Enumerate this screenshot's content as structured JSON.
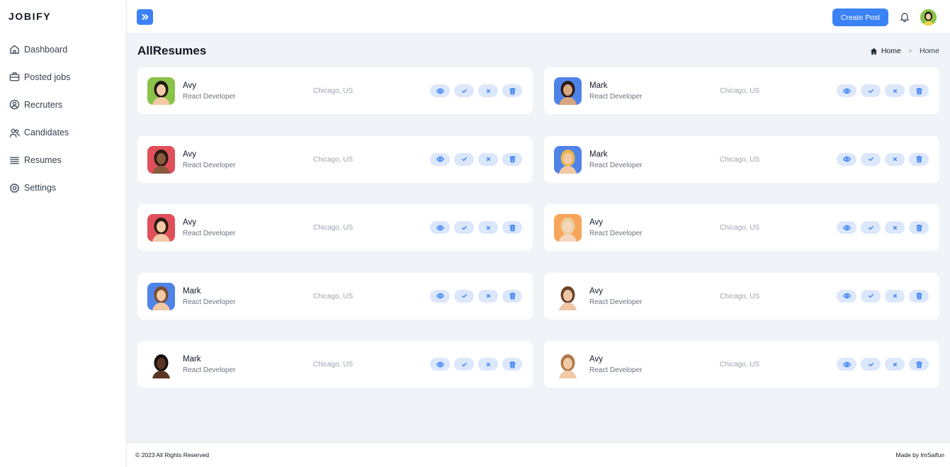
{
  "brand": "JOBIFY",
  "sidebar": {
    "items": [
      {
        "label": "Dashboard",
        "icon": "home-icon"
      },
      {
        "label": "Posted jobs",
        "icon": "briefcase-icon"
      },
      {
        "label": "Recruters",
        "icon": "user-circle-icon"
      },
      {
        "label": "Candidates",
        "icon": "users-icon"
      },
      {
        "label": "Resumes",
        "icon": "list-icon"
      },
      {
        "label": "Settings",
        "icon": "gear-icon"
      }
    ]
  },
  "topbar": {
    "create_label": "Create Post",
    "toggle_icon": "double-chevron-right-icon",
    "bell_icon": "bell-icon"
  },
  "page": {
    "title": "AllResumes",
    "breadcrumb": [
      "Home",
      "Home"
    ]
  },
  "resumes": [
    {
      "name": "Avy",
      "role": "React Developer",
      "location": "Chicago, US",
      "avatar_bg": "#8bc34a",
      "skin": "#f1c9a5",
      "hair": "#1f1612"
    },
    {
      "name": "Mark",
      "role": "React Developer",
      "location": "Chicago, US",
      "avatar_bg": "#4f83e8",
      "skin": "#d9a77f",
      "hair": "#2a1d16"
    },
    {
      "name": "Avy",
      "role": "React Developer",
      "location": "Chicago, US",
      "avatar_bg": "#e0505a",
      "skin": "#8a5a3c",
      "hair": "#2a1a12"
    },
    {
      "name": "Mark",
      "role": "React Developer",
      "location": "Chicago, US",
      "avatar_bg": "#4f83e8",
      "skin": "#f1c9a5",
      "hair": "#e6b84a"
    },
    {
      "name": "Avy",
      "role": "React Developer",
      "location": "Chicago, US",
      "avatar_bg": "#e0505a",
      "skin": "#f1c9a5",
      "hair": "#2a1a12"
    },
    {
      "name": "Avy",
      "role": "React Developer",
      "location": "Chicago, US",
      "avatar_bg": "#f7a55a",
      "skin": "#f6d6bd",
      "hair": "#e8cf9a"
    },
    {
      "name": "Mark",
      "role": "React Developer",
      "location": "Chicago, US",
      "avatar_bg": "#4f83e8",
      "skin": "#f1c9a5",
      "hair": "#7a4a2c"
    },
    {
      "name": "Avy",
      "role": "React Developer",
      "location": "Chicago, US",
      "avatar_bg": "#ffffff",
      "skin": "#efc6a7",
      "hair": "#6b4427"
    },
    {
      "name": "Mark",
      "role": "React Developer",
      "location": "Chicago, US",
      "avatar_bg": "#ffffff",
      "skin": "#5a3622",
      "hair": "#161010"
    },
    {
      "name": "Avy",
      "role": "React Developer",
      "location": "Chicago, US",
      "avatar_bg": "#ffffff",
      "skin": "#f1c9a5",
      "hair": "#b07a4a"
    }
  ],
  "actions": [
    {
      "icon": "eye-icon"
    },
    {
      "icon": "check-icon"
    },
    {
      "icon": "close-icon"
    },
    {
      "icon": "trash-icon"
    }
  ],
  "footer": {
    "left": "© 2023 All Rights Reserved",
    "right": "Made by ImSaifun"
  },
  "colors": {
    "accent": "#3b82f6",
    "action_bg": "#dbe7fb",
    "page_bg": "#f0f3f8"
  }
}
